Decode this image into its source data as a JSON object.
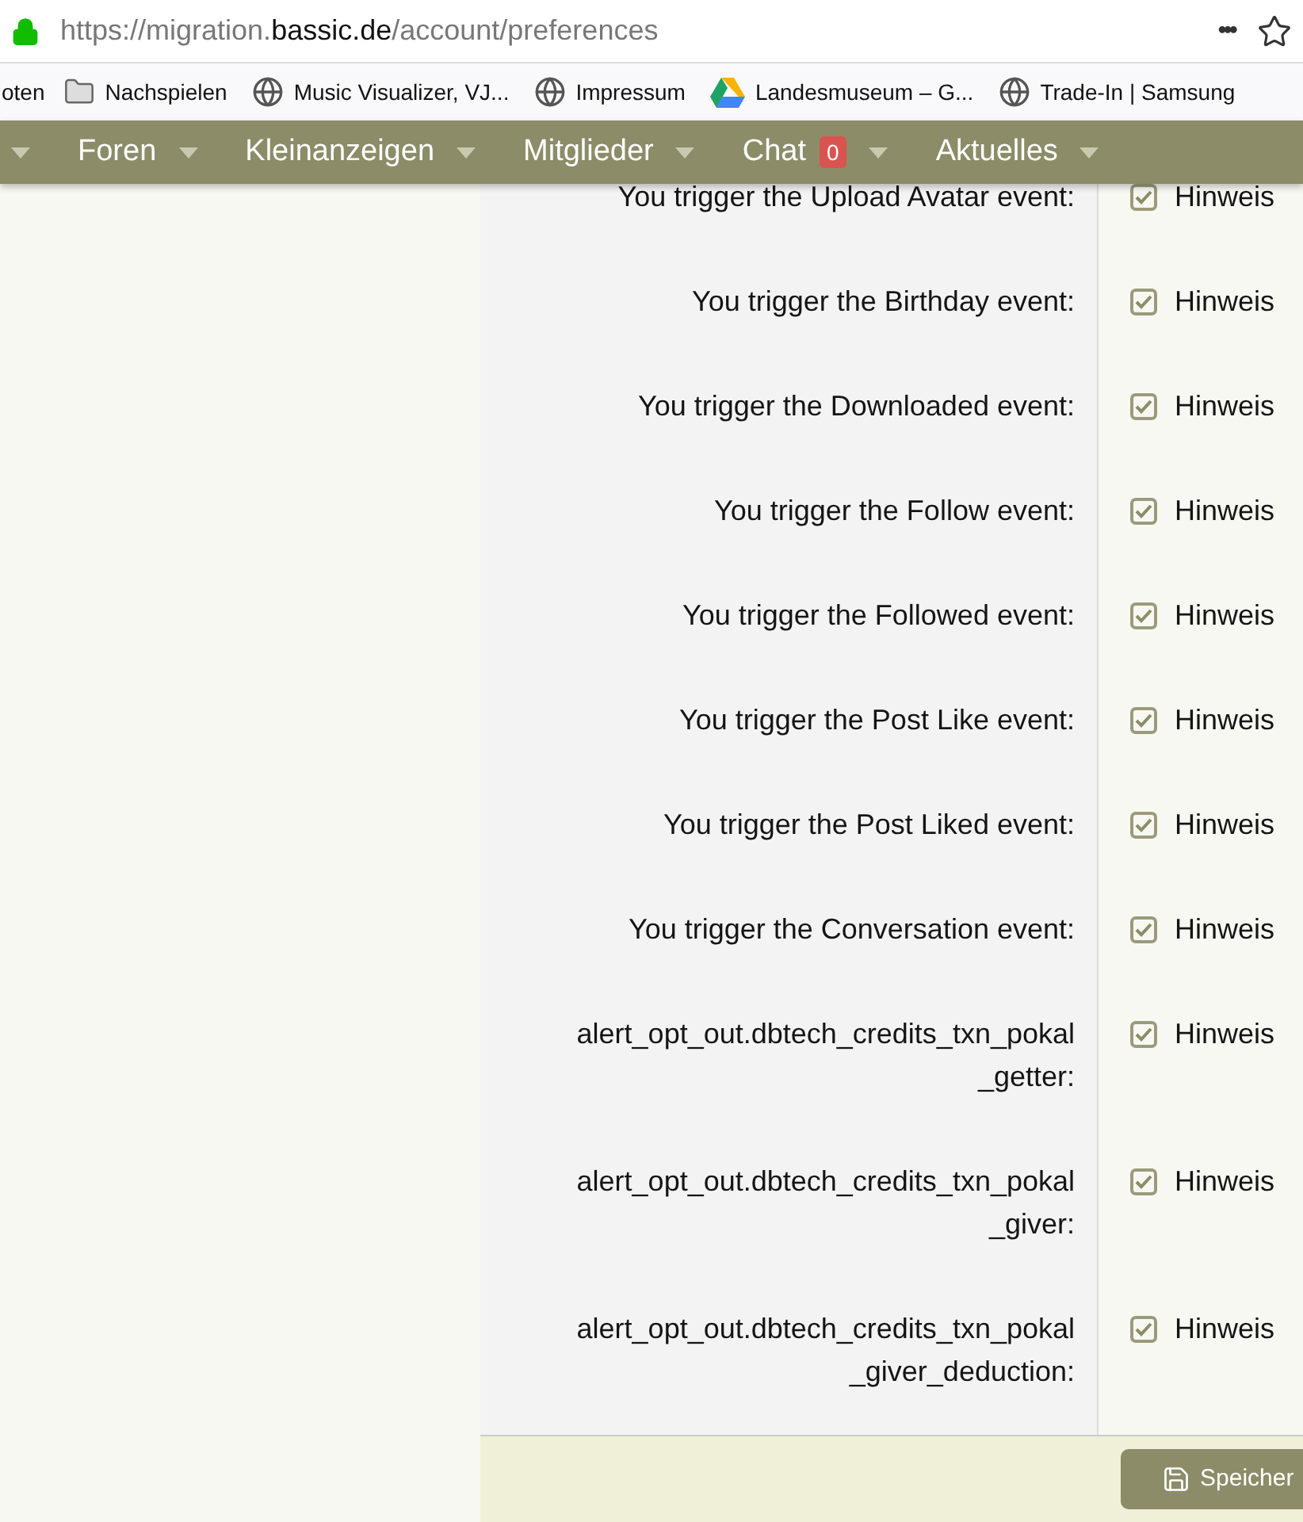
{
  "address_bar": {
    "url_prefix": "https://migration.",
    "url_domain": "bassic.de",
    "url_path": "/account/preferences",
    "more": "•••"
  },
  "bookmarks": [
    {
      "label": "oten",
      "kind": "none"
    },
    {
      "label": "Nachspielen",
      "kind": "folder"
    },
    {
      "label": "Music Visualizer, VJ...",
      "kind": "globe"
    },
    {
      "label": "Impressum",
      "kind": "globe"
    },
    {
      "label": "Landesmuseum – G...",
      "kind": "drive"
    },
    {
      "label": "Trade-In | Samsung",
      "kind": "globe"
    }
  ],
  "nav": [
    {
      "label": "Foren"
    },
    {
      "label": "Kleinanzeigen"
    },
    {
      "label": "Mitglieder"
    },
    {
      "label": "Chat",
      "badge": "0"
    },
    {
      "label": "Aktuelles"
    }
  ],
  "alerts": [
    {
      "label": "You trigger the Upload Avatar event:",
      "option": "Hinweis",
      "checked": true
    },
    {
      "label": "You trigger the Birthday event:",
      "option": "Hinweis",
      "checked": true
    },
    {
      "label": "You trigger the Downloaded event:",
      "option": "Hinweis",
      "checked": true
    },
    {
      "label": "You trigger the Follow event:",
      "option": "Hinweis",
      "checked": true
    },
    {
      "label": "You trigger the Followed event:",
      "option": "Hinweis",
      "checked": true
    },
    {
      "label": "You trigger the Post Like event:",
      "option": "Hinweis",
      "checked": true
    },
    {
      "label": "You trigger the Post Liked event:",
      "option": "Hinweis",
      "checked": true
    },
    {
      "label": "You trigger the Conversation event:",
      "option": "Hinweis",
      "checked": true
    },
    {
      "label": "alert_opt_out.dbtech_credits_txn_pokal\n_getter:",
      "option": "Hinweis",
      "checked": true
    },
    {
      "label": "alert_opt_out.dbtech_credits_txn_pokal\n_giver:",
      "option": "Hinweis",
      "checked": true
    },
    {
      "label": "alert_opt_out.dbtech_credits_txn_pokal\n_giver_deduction:",
      "option": "Hinweis",
      "checked": true
    }
  ],
  "save_button": "Speicher"
}
